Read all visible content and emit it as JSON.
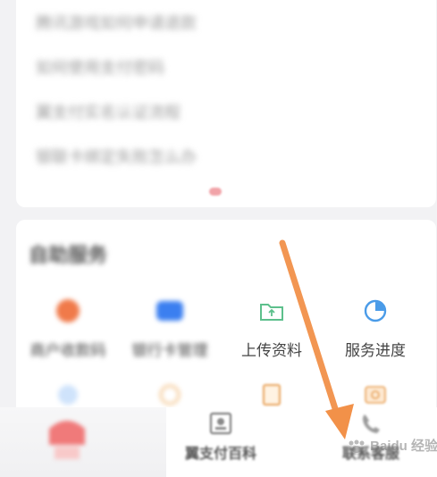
{
  "faq": {
    "items": [
      "腾讯游戏如何申请退款",
      "如何使用支付密码",
      "翼支付实名认证流程",
      "银联卡绑定失败怎么办"
    ]
  },
  "services": {
    "title": "自助服务",
    "items": [
      {
        "label": "商户收款码",
        "icon": "orange-circle-icon",
        "blurred": true
      },
      {
        "label": "银行卡管理",
        "icon": "bank-card-icon",
        "blurred": true
      },
      {
        "label": "上传资料",
        "icon": "upload-folder-icon",
        "blurred": false
      },
      {
        "label": "服务进度",
        "icon": "progress-pie-icon",
        "blurred": false
      }
    ]
  },
  "bottom_nav": {
    "encyclopedia_label": "翼支付百科",
    "contact_label": "联系客服"
  },
  "watermark": "Baidu 经验",
  "colors": {
    "arrow": "#f29149",
    "upload_icon": "#5dc08c",
    "progress_icon": "#4a9be8",
    "orange_icon": "#f07a4a",
    "bank_icon": "#3b7ff0"
  }
}
